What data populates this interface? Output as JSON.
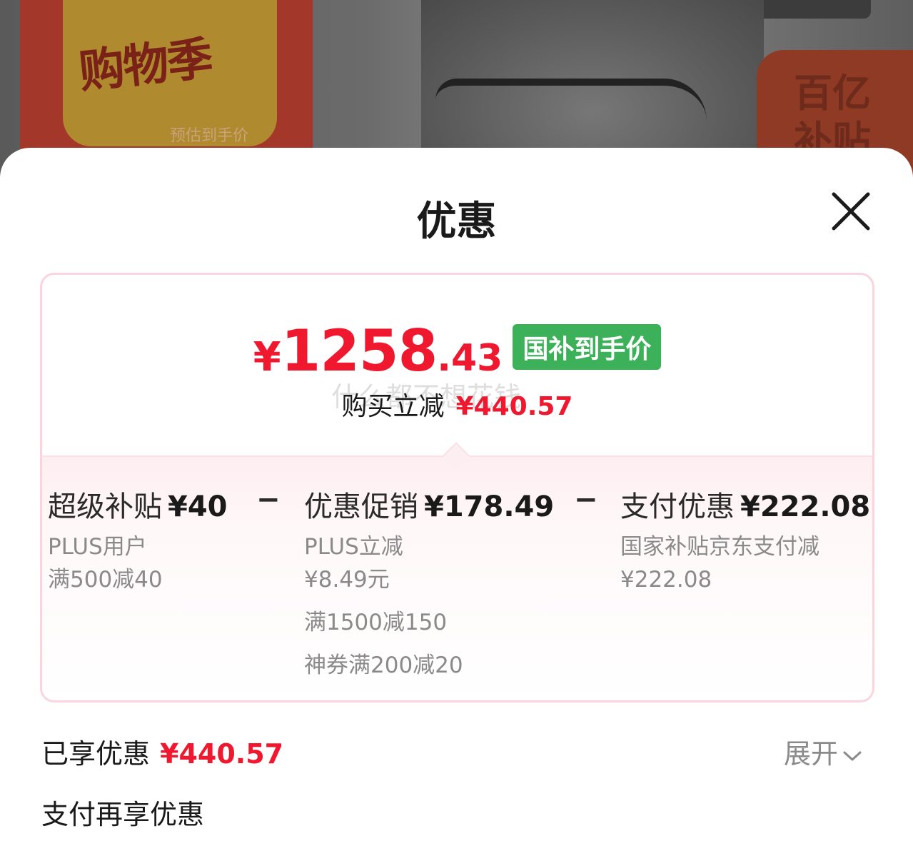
{
  "background": {
    "promo_title": "购物季",
    "promo_sub": "预估到手价",
    "badge_text": "百亿补贴"
  },
  "sheet": {
    "title": "优惠",
    "close_icon": "close-icon"
  },
  "price_card": {
    "yen": "¥",
    "price_int": "1258",
    "price_dec": ".43",
    "tag": "国补到手价",
    "reduce_label": "购买立减",
    "reduce_value": "¥440.57",
    "watermark": "什么都不想花钱",
    "columns": [
      {
        "title": "超级补贴",
        "amount": "¥40",
        "lines": [
          "PLUS用户",
          "满500减40"
        ]
      },
      {
        "title": "优惠促销",
        "amount": "¥178.49",
        "lines": [
          "PLUS立减",
          "¥8.49元",
          "满1500减150",
          "神券满200减20"
        ]
      },
      {
        "title": "支付优惠",
        "amount": "¥222.08",
        "lines": [
          "国家补贴京东支付减",
          "¥222.08"
        ]
      }
    ],
    "minus_symbol": "−"
  },
  "enjoyed": {
    "label": "已享优惠",
    "value": "¥440.57",
    "expand_label": "展开",
    "expand_icon": "chevron-down-icon"
  },
  "pay_more": {
    "label": "支付再享优惠"
  },
  "colors": {
    "accent_red": "#f0182e",
    "tag_green": "#3cb15a",
    "card_border": "#fbd5dd"
  }
}
